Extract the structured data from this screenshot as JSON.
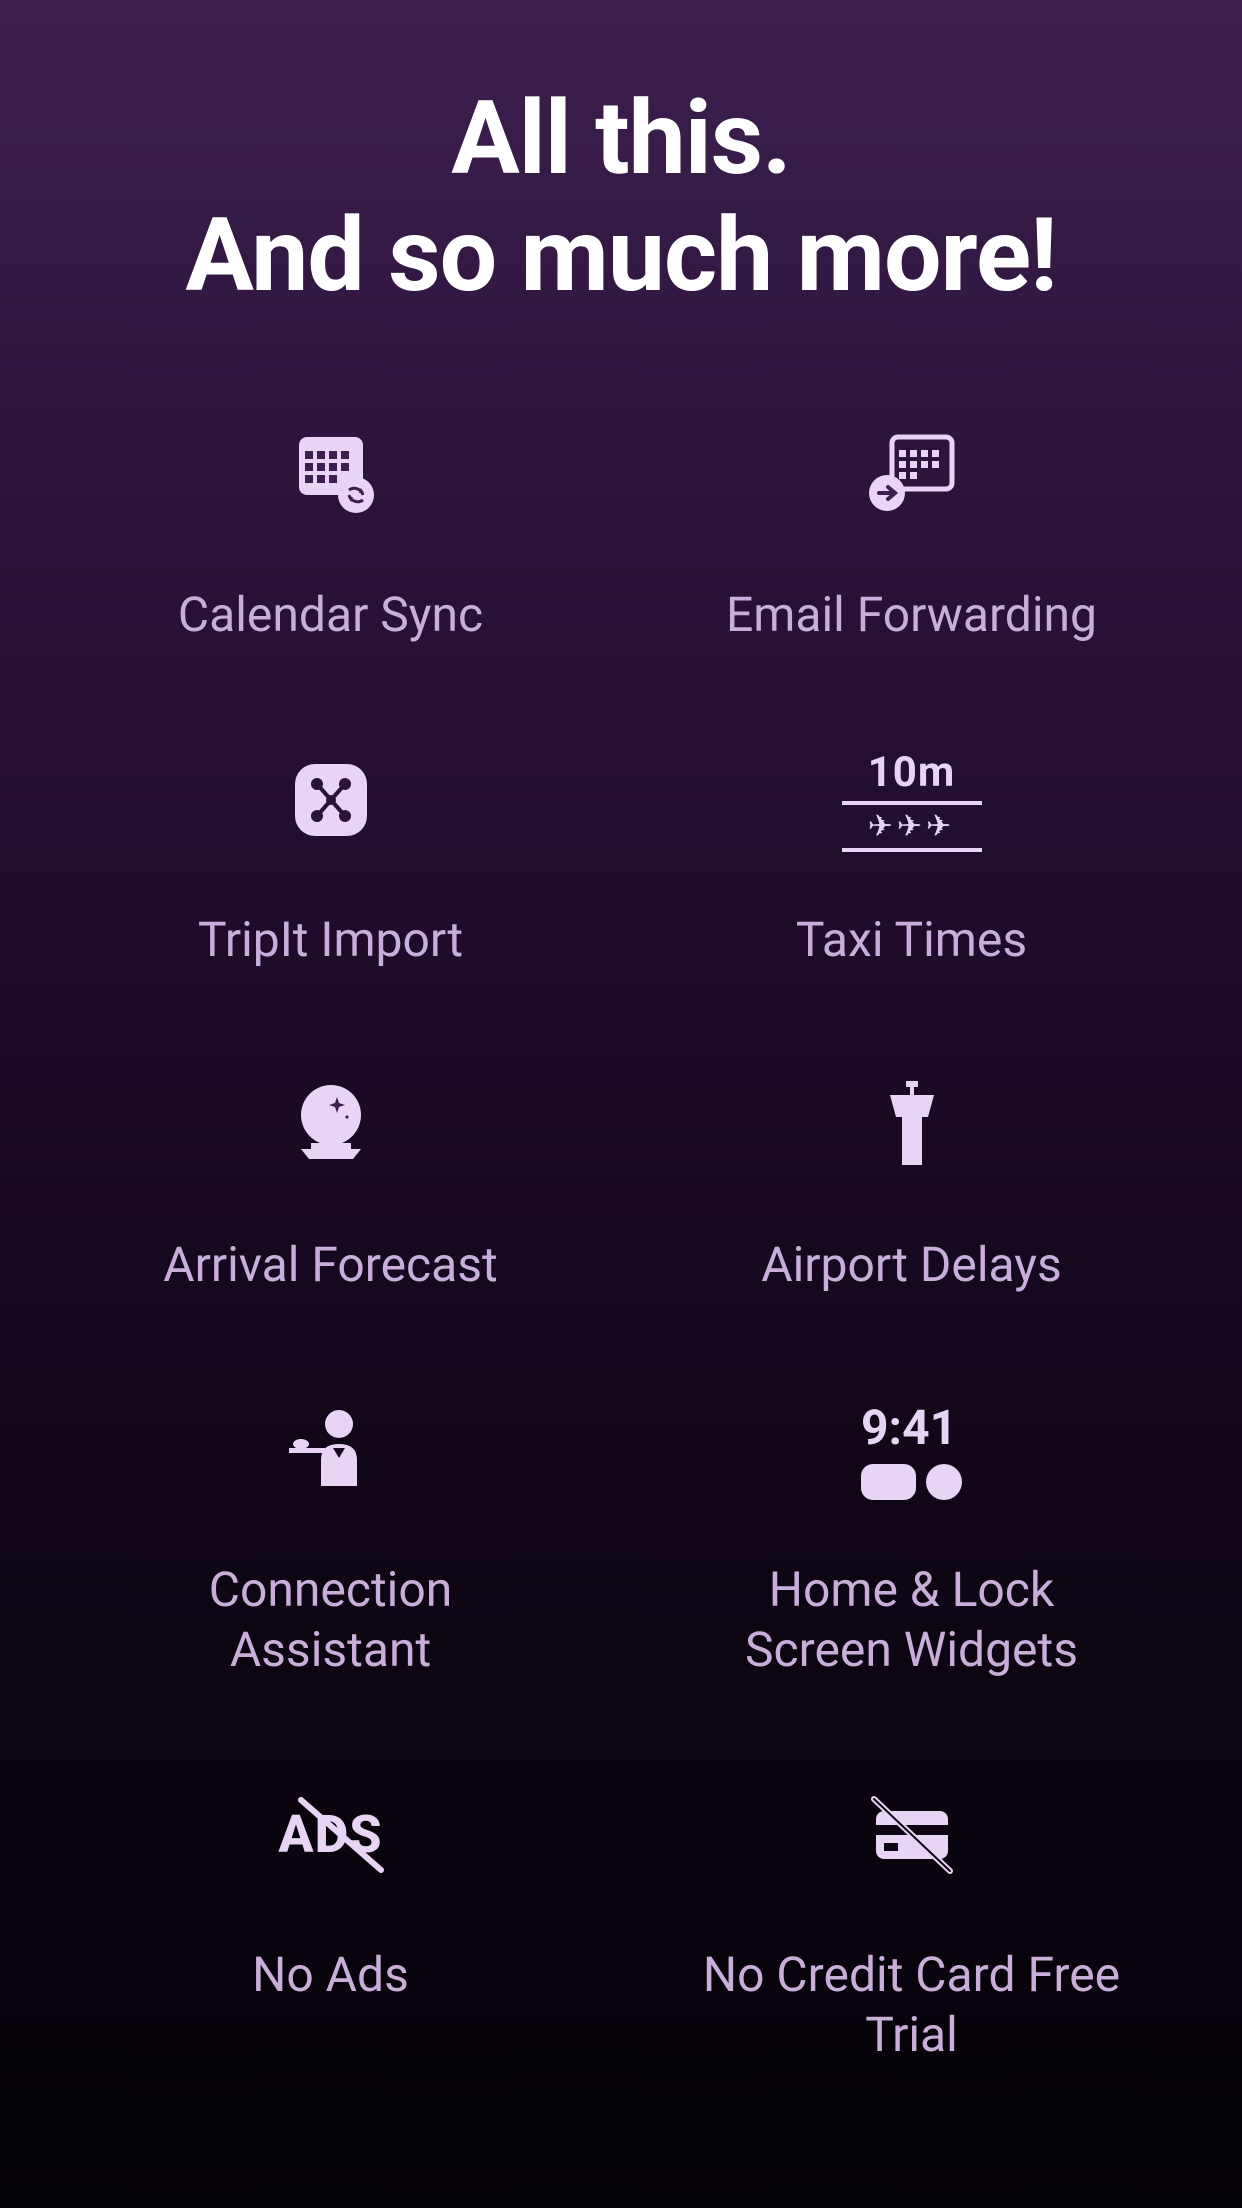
{
  "heading": {
    "line1": "All this.",
    "line2": "And so much more!"
  },
  "features": [
    {
      "label": "Calendar Sync",
      "icon": "calendar-sync"
    },
    {
      "label": "Email Forwarding",
      "icon": "email-forward"
    },
    {
      "label": "TripIt Import",
      "icon": "tripit"
    },
    {
      "label": "Taxi Times",
      "icon": "taxi-times",
      "iconText": "10m"
    },
    {
      "label": "Arrival Forecast",
      "icon": "crystal-ball"
    },
    {
      "label": "Airport Delays",
      "icon": "control-tower"
    },
    {
      "label": "Connection Assistant",
      "icon": "concierge"
    },
    {
      "label": "Home & Lock Screen Widgets",
      "icon": "widgets",
      "iconText": "9:41"
    },
    {
      "label": "No Ads",
      "icon": "no-ads",
      "iconText": "ADS"
    },
    {
      "label": "No Credit Card Free Trial",
      "icon": "no-card"
    }
  ]
}
